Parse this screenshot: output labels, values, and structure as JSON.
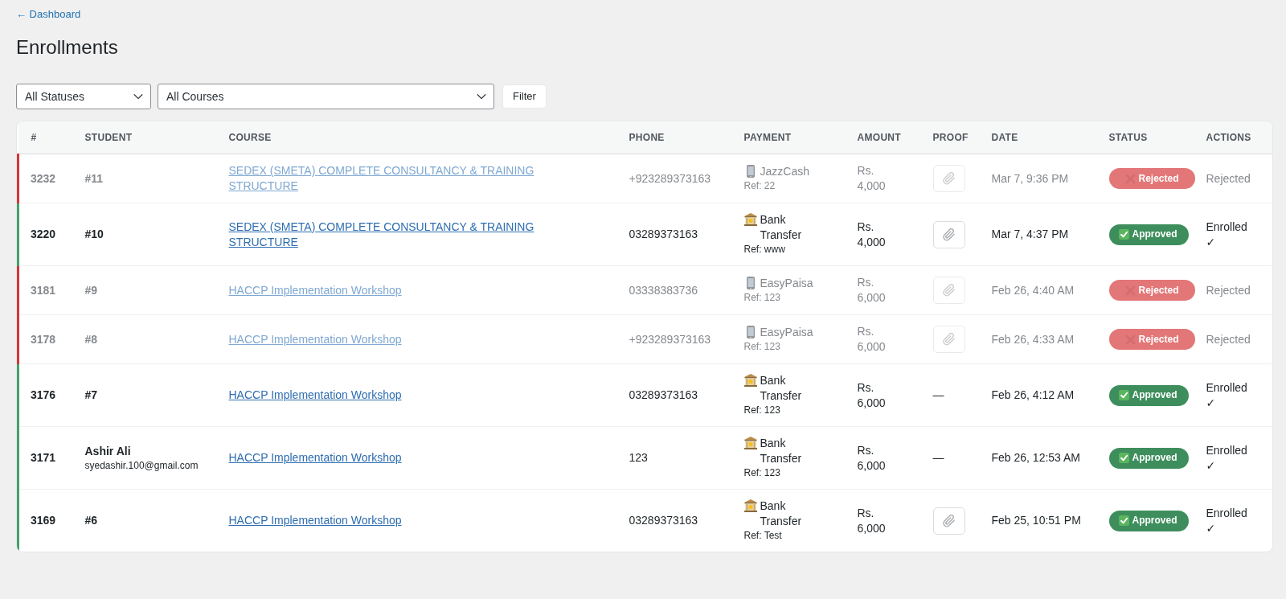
{
  "back_link": "← Dashboard",
  "title": "Enrollments",
  "filters": {
    "status_select": {
      "value": "All Statuses"
    },
    "course_select": {
      "value": "All Courses"
    },
    "filter_button": "Filter"
  },
  "table": {
    "columns": [
      "#",
      "STUDENT",
      "COURSE",
      "PHONE",
      "PAYMENT",
      "AMOUNT",
      "PROOF",
      "DATE",
      "STATUS",
      "ACTIONS"
    ],
    "rows": [
      {
        "id": "3232",
        "student": {
          "name": "#11"
        },
        "course": "SEDEX (SMETA) COMPLETE CONSULTANCY & TRAINING STRUCTURE",
        "phone": "+923289373163",
        "payment": {
          "kind": "mobile",
          "method": "JazzCash",
          "ref": "Ref: 22"
        },
        "amount": "Rs. 4,000",
        "proof": {
          "kind": "file"
        },
        "date": "Mar 7, 9:36 PM",
        "status": {
          "kind": "rejected",
          "label": "Rejected"
        },
        "action": "Rejected"
      },
      {
        "id": "3220",
        "student": {
          "name": "#10"
        },
        "course": "SEDEX (SMETA) COMPLETE CONSULTANCY & TRAINING STRUCTURE",
        "phone": "03289373163",
        "payment": {
          "kind": "bank",
          "method": "Bank Transfer",
          "ref": "Ref: www"
        },
        "amount": "Rs. 4,000",
        "proof": {
          "kind": "file"
        },
        "date": "Mar 7, 4:37 PM",
        "status": {
          "kind": "approved",
          "label": "Approved"
        },
        "action": "Enrolled ✓"
      },
      {
        "id": "3181",
        "student": {
          "name": "#9"
        },
        "course": "HACCP Implementation Workshop",
        "phone": "03338383736",
        "payment": {
          "kind": "mobile",
          "method": "EasyPaisa",
          "ref": "Ref: 123"
        },
        "amount": "Rs. 6,000",
        "proof": {
          "kind": "file"
        },
        "date": "Feb 26, 4:40 AM",
        "status": {
          "kind": "rejected",
          "label": "Rejected"
        },
        "action": "Rejected"
      },
      {
        "id": "3178",
        "student": {
          "name": "#8"
        },
        "course": "HACCP Implementation Workshop",
        "phone": "+923289373163",
        "payment": {
          "kind": "mobile",
          "method": "EasyPaisa",
          "ref": "Ref: 123"
        },
        "amount": "Rs. 6,000",
        "proof": {
          "kind": "file"
        },
        "date": "Feb 26, 4:33 AM",
        "status": {
          "kind": "rejected",
          "label": "Rejected"
        },
        "action": "Rejected"
      },
      {
        "id": "3176",
        "student": {
          "name": "#7"
        },
        "course": "HACCP Implementation Workshop",
        "phone": "03289373163",
        "payment": {
          "kind": "bank",
          "method": "Bank Transfer",
          "ref": "Ref: 123"
        },
        "amount": "Rs. 6,000",
        "proof": {
          "kind": "none",
          "text": "—"
        },
        "date": "Feb 26, 4:12 AM",
        "status": {
          "kind": "approved",
          "label": "Approved"
        },
        "action": "Enrolled ✓"
      },
      {
        "id": "3171",
        "student": {
          "name": "Ashir Ali",
          "email": "syedashir.100@gmail.com"
        },
        "course": "HACCP Implementation Workshop",
        "phone": "123",
        "payment": {
          "kind": "bank",
          "method": "Bank Transfer",
          "ref": "Ref: 123"
        },
        "amount": "Rs. 6,000",
        "proof": {
          "kind": "none",
          "text": "—"
        },
        "date": "Feb 26, 12:53 AM",
        "status": {
          "kind": "approved",
          "label": "Approved"
        },
        "action": "Enrolled ✓"
      },
      {
        "id": "3169",
        "student": {
          "name": "#6"
        },
        "course": "HACCP Implementation Workshop",
        "phone": "03289373163",
        "payment": {
          "kind": "bank",
          "method": "Bank Transfer",
          "ref": "Ref: Test"
        },
        "amount": "Rs. 6,000",
        "proof": {
          "kind": "file"
        },
        "date": "Feb 25, 10:51 PM",
        "status": {
          "kind": "approved",
          "label": "Approved"
        },
        "action": "Enrolled ✓"
      }
    ]
  }
}
